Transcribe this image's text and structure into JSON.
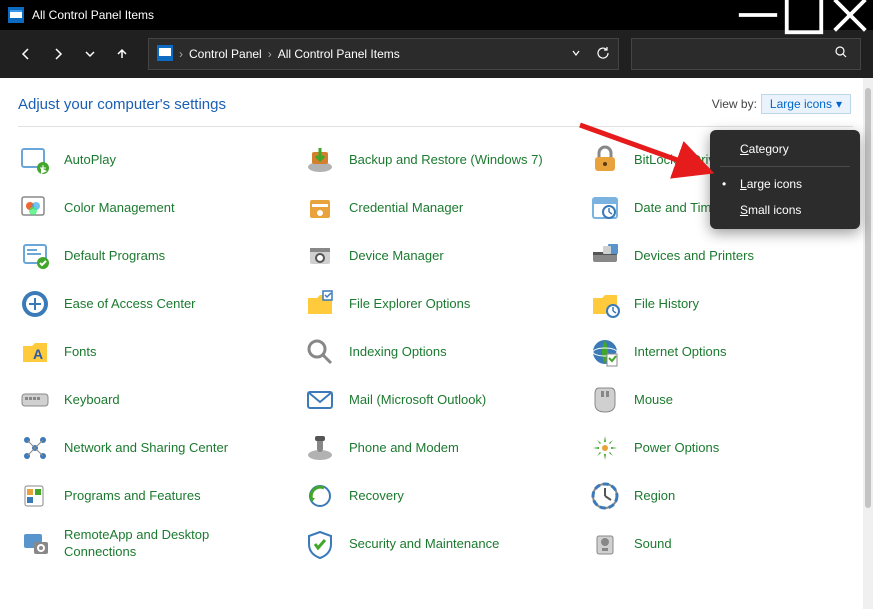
{
  "window": {
    "title": "All Control Panel Items"
  },
  "breadcrumb": {
    "root": "Control Panel",
    "current": "All Control Panel Items"
  },
  "header": {
    "heading": "Adjust your computer's settings",
    "viewby_label": "View by:",
    "viewby_value": "Large icons"
  },
  "dropdown": {
    "items": [
      {
        "label": "Category",
        "selected": false
      },
      {
        "label": "Large icons",
        "selected": true
      },
      {
        "label": "Small icons",
        "selected": false
      }
    ]
  },
  "items": [
    {
      "label": "AutoPlay"
    },
    {
      "label": "Backup and Restore (Windows 7)"
    },
    {
      "label": "BitLocker Drive Encryption"
    },
    {
      "label": "Color Management"
    },
    {
      "label": "Credential Manager"
    },
    {
      "label": "Date and Time"
    },
    {
      "label": "Default Programs"
    },
    {
      "label": "Device Manager"
    },
    {
      "label": "Devices and Printers"
    },
    {
      "label": "Ease of Access Center"
    },
    {
      "label": "File Explorer Options"
    },
    {
      "label": "File History"
    },
    {
      "label": "Fonts"
    },
    {
      "label": "Indexing Options"
    },
    {
      "label": "Internet Options"
    },
    {
      "label": "Keyboard"
    },
    {
      "label": "Mail (Microsoft Outlook)"
    },
    {
      "label": "Mouse"
    },
    {
      "label": "Network and Sharing Center"
    },
    {
      "label": "Phone and Modem"
    },
    {
      "label": "Power Options"
    },
    {
      "label": "Programs and Features"
    },
    {
      "label": "Recovery"
    },
    {
      "label": "Region"
    },
    {
      "label": "RemoteApp and Desktop Connections"
    },
    {
      "label": "Security and Maintenance"
    },
    {
      "label": "Sound"
    }
  ]
}
